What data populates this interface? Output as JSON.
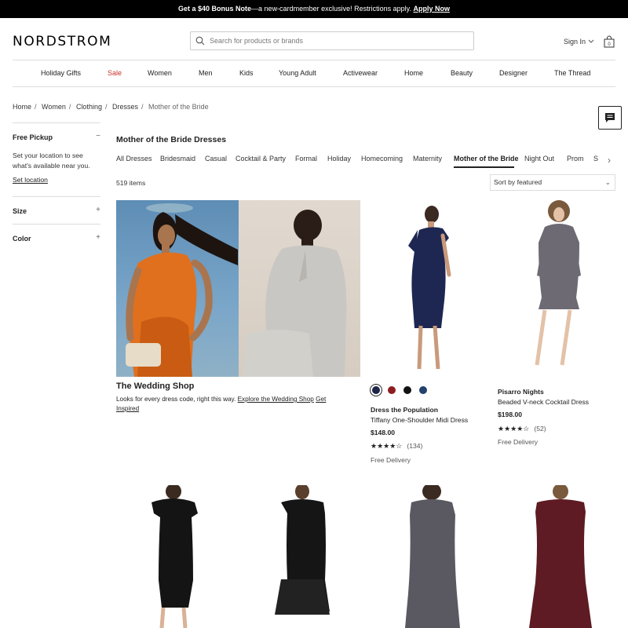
{
  "promo": {
    "bold": "Get a $40 Bonus Note",
    "text": "—a new-cardmember exclusive! Restrictions apply.",
    "link": "Apply Now"
  },
  "header": {
    "logo": "NORDSTROM",
    "search_placeholder": "Search for products or brands",
    "signin": "Sign In",
    "bag_count": "0"
  },
  "nav": [
    "Holiday Gifts",
    "Sale",
    "Women",
    "Men",
    "Kids",
    "Young Adult",
    "Activewear",
    "Home",
    "Beauty",
    "Designer",
    "The Thread"
  ],
  "colors": {
    "sale": "#c8322c",
    "accent": "#222222"
  },
  "breadcrumb": [
    "Home",
    "Women",
    "Clothing",
    "Dresses",
    "Mother of the Bride"
  ],
  "sidebar": {
    "free_pickup": "Free Pickup",
    "pickup_text": "Set your location to see what's available near you.",
    "set_location": "Set location",
    "size": "Size",
    "color": "Color"
  },
  "category": {
    "title": "Mother of the Bride Dresses",
    "tabs": [
      "All Dresses",
      "Bridesmaid",
      "Casual",
      "Cocktail & Party",
      "Formal",
      "Holiday",
      "Homecoming",
      "Maternity",
      "Mother of the Bride",
      "Night Out",
      "Prom",
      "S"
    ],
    "active_tab": "Mother of the Bride",
    "count": "519 items",
    "sort": "Sort by featured"
  },
  "promo_tile": {
    "title": "The Wedding Shop",
    "text": "Looks for every dress code, right this way.",
    "link1": "Explore the Wedding Shop",
    "link2": "Get Inspired"
  },
  "products": [
    {
      "brand": "Dress the Population",
      "name": "Tiffany One-Shoulder Midi Dress",
      "price": "$148.00",
      "stars": "★★★★☆",
      "reviews": "(134)",
      "delivery": "Free Delivery",
      "swatches": [
        "#1c2447",
        "#8e1d22",
        "#111111",
        "#23406e"
      ]
    },
    {
      "brand": "Pisarro Nights",
      "name": "Beaded V-neck Cocktail Dress",
      "price": "$198.00",
      "stars": "★★★★☆",
      "reviews": "(52)",
      "delivery": "Free Delivery"
    }
  ]
}
